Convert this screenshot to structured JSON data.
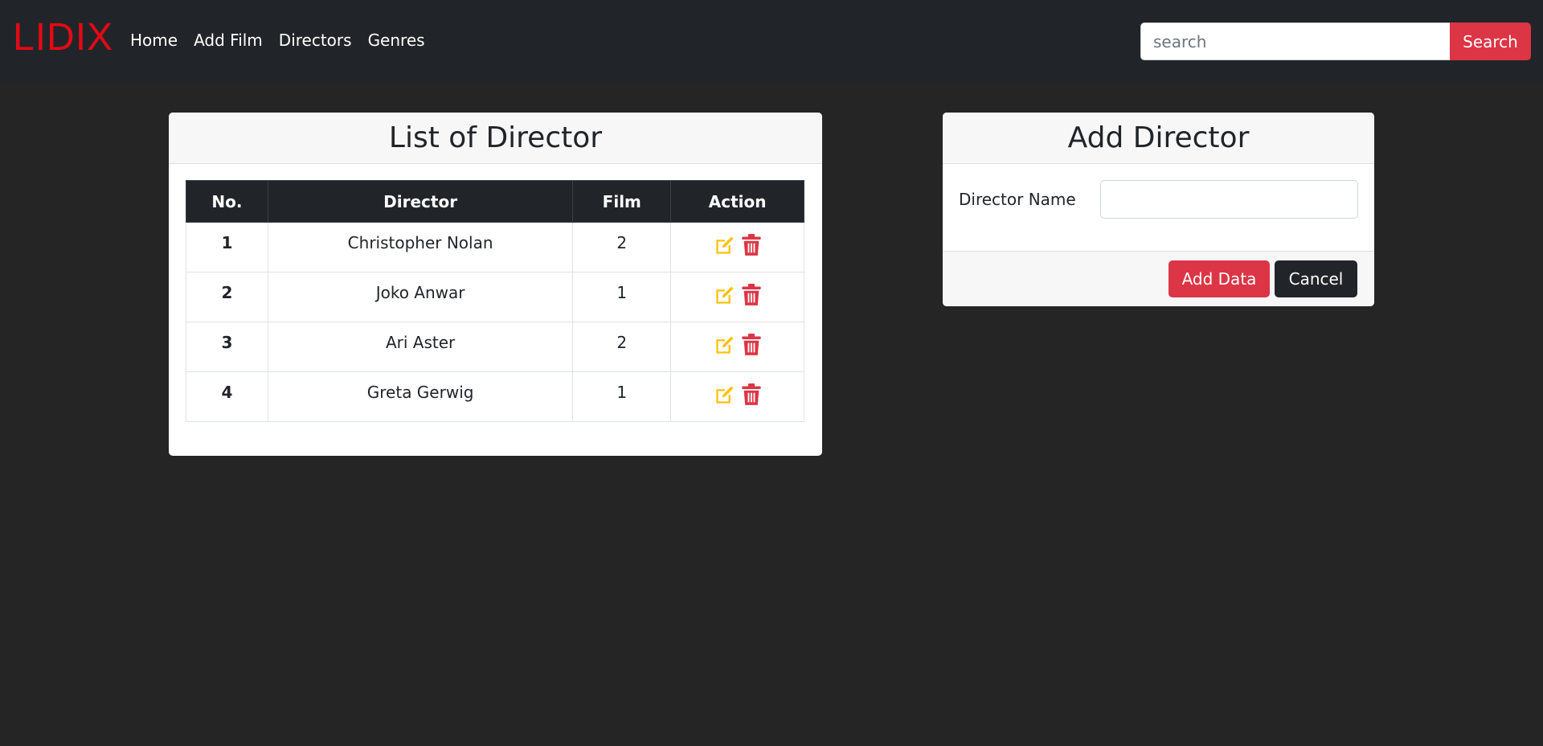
{
  "brand": "LIDIX",
  "nav": {
    "links": [
      "Home",
      "Add Film",
      "Directors",
      "Genres"
    ]
  },
  "search": {
    "placeholder": "search",
    "value": "",
    "button_label": "Search"
  },
  "list_card": {
    "title": "List of Director",
    "columns": [
      "No.",
      "Director",
      "Film",
      "Action"
    ],
    "rows": [
      {
        "no": "1",
        "director": "Christopher Nolan",
        "film": "2"
      },
      {
        "no": "2",
        "director": "Joko Anwar",
        "film": "1"
      },
      {
        "no": "3",
        "director": "Ari Aster",
        "film": "2"
      },
      {
        "no": "4",
        "director": "Greta Gerwig",
        "film": "1"
      }
    ],
    "action_icons": [
      "edit-icon",
      "trash-icon"
    ]
  },
  "add_card": {
    "title": "Add Director",
    "field_label": "Director Name",
    "field_value": "",
    "add_button": "Add Data",
    "cancel_button": "Cancel"
  },
  "colors": {
    "brand": "#e50914",
    "navbar": "#212529",
    "background": "#252525",
    "danger": "#dc3545",
    "edit_icon": "#ffc107",
    "dark_button": "#212529"
  }
}
